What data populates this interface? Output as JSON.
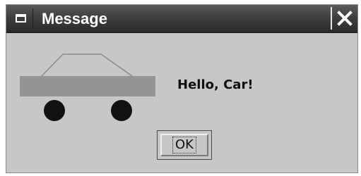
{
  "window": {
    "title": "Message",
    "menu_icon": "window-menu-icon",
    "close_icon": "close-icon"
  },
  "message": {
    "icon": "car-icon",
    "text": "Hello, Car!"
  },
  "buttons": {
    "ok_label": "OK"
  },
  "colors": {
    "titlebar": "#3f3f3f",
    "dialog_background": "#c7c7c7",
    "car_body": "#949494",
    "wheels": "#111111"
  }
}
